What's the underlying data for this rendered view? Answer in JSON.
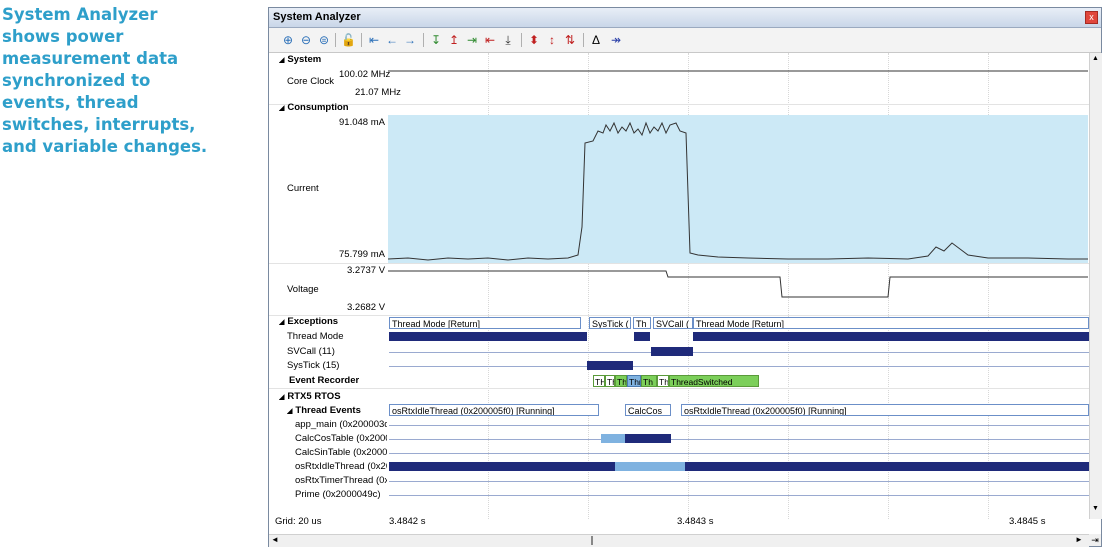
{
  "caption": {
    "line1": "System Analyzer",
    "line2": "shows power",
    "line3": "measurement data",
    "line4": "synchronized to",
    "line5": "events, thread",
    "line6": "switches, interrupts,",
    "line7": "and variable changes."
  },
  "window": {
    "title": "System Analyzer",
    "close_glyph": "x"
  },
  "toolbar": {
    "icons": [
      "zoom-in-icon",
      "zoom-out-icon",
      "zoom-fit-icon",
      "lock-icon",
      "go-start-icon",
      "go-back-icon",
      "go-forward-icon",
      "marker-1-icon",
      "marker-2-icon",
      "marker-3-icon",
      "marker-4-icon",
      "marker-5-icon",
      "marker-6-icon",
      "marker-7-icon",
      "marker-8-icon",
      "delta-icon",
      "jump-end-icon"
    ]
  },
  "groups": {
    "system": "System",
    "consumption": "Consumption",
    "exceptions": "Exceptions",
    "rtos": "RTX5 RTOS",
    "thread_events": "Thread Events"
  },
  "rows": {
    "core_clock": "Core Clock",
    "core_clock_max": "100.02 MHz",
    "core_clock_min": "21.07 MHz",
    "current": "Current",
    "current_max": "91.048 mA",
    "current_min": "75.799 mA",
    "voltage": "Voltage",
    "voltage_max": "3.2737 V",
    "voltage_min": "3.2682 V",
    "thread_mode": "Thread Mode",
    "svcall": "SVCall (11)",
    "systick": "SysTick (15)",
    "event_recorder": "Event Recorder",
    "app_main": "app_main (0x200003d8",
    "calccos": "CalcCosTable (0x2000",
    "calcsin": "CalcSinTable (0x20000",
    "idle": "osRtxIdleThread (0x20",
    "timer": "osRtxTimerThread (0x2",
    "prime": "Prime (0x2000049c)"
  },
  "exception_segments": {
    "s1": "Thread Mode [Return]",
    "s2": "SysTick (",
    "s3": "Th",
    "s4": "SVCall (",
    "s5": "Thread Mode [Return]"
  },
  "event_labels": {
    "e1": "TH",
    "e2": "Th",
    "e3": "Th",
    "e4": "Thr",
    "e5": "Th",
    "e6": "Th",
    "e7": "ThreadSwitched"
  },
  "thread_segments": {
    "t1": "osRtxIdleThread (0x200005f0) [Running]",
    "t2": "CalcCos",
    "t3": "osRtxIdleThread (0x200005f0) [Running]"
  },
  "status": {
    "grid": "Grid: 20 us",
    "t1": "3.4842 s",
    "t2": "3.4843 s",
    "t3": "3.4845 s"
  },
  "colors": {
    "caption": "#2e9fca",
    "consumption_bg": "#cce9f6",
    "thread_navy": "#1f2a7a",
    "thread_light": "#7fb2e0",
    "event_green": "#7ccf5a"
  }
}
